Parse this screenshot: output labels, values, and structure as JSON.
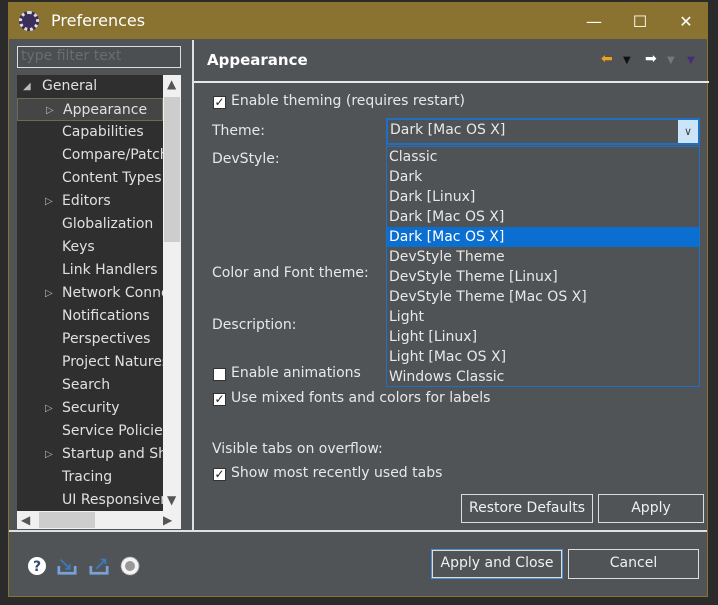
{
  "window": {
    "title": "Preferences",
    "minimize": "—",
    "maximize": "☐",
    "close": "✕"
  },
  "filter": {
    "placeholder": "type filter text"
  },
  "tree": {
    "items": [
      {
        "label": "General",
        "level": 0,
        "expanded": true
      },
      {
        "label": "Appearance",
        "level": 1,
        "expandable": true,
        "selected": true
      },
      {
        "label": "Capabilities",
        "level": 1
      },
      {
        "label": "Compare/Patch",
        "level": 1
      },
      {
        "label": "Content Types",
        "level": 1
      },
      {
        "label": "Editors",
        "level": 1,
        "expandable": true
      },
      {
        "label": "Globalization",
        "level": 1
      },
      {
        "label": "Keys",
        "level": 1
      },
      {
        "label": "Link Handlers",
        "level": 1
      },
      {
        "label": "Network Connections",
        "level": 1,
        "expandable": true
      },
      {
        "label": "Notifications",
        "level": 1
      },
      {
        "label": "Perspectives",
        "level": 1
      },
      {
        "label": "Project Natures",
        "level": 1
      },
      {
        "label": "Search",
        "level": 1
      },
      {
        "label": "Security",
        "level": 1,
        "expandable": true
      },
      {
        "label": "Service Policies",
        "level": 1
      },
      {
        "label": "Startup and Shutdown",
        "level": 1,
        "expandable": true
      },
      {
        "label": "Tracing",
        "level": 1
      },
      {
        "label": "UI Responsiveness",
        "level": 1
      }
    ]
  },
  "page": {
    "title": "Appearance",
    "enable_theming": {
      "label": "Enable theming (requires restart)",
      "checked": true
    },
    "theme_label": "Theme:",
    "theme_value": "Dark [Mac OS X]",
    "theme_options": [
      "Classic",
      "Dark",
      "Dark [Linux]",
      "Dark [Mac OS X]",
      "Dark [Mac OS X]",
      "DevStyle Theme",
      "DevStyle Theme [Linux]",
      "DevStyle Theme [Mac OS X]",
      "Light",
      "Light [Linux]",
      "Light [Mac OS X]",
      "Windows Classic"
    ],
    "theme_highlighted_index": 4,
    "devstyle_label": "DevStyle:",
    "color_font_label": "Color and Font theme:",
    "description_label": "Description:",
    "enable_animations": {
      "label": "Enable animations",
      "checked": false
    },
    "mixed_fonts": {
      "label": "Use mixed fonts and colors for labels",
      "checked": true
    },
    "visible_tabs_label": "Visible tabs on overflow:",
    "show_mru": {
      "label": "Show most recently used tabs",
      "checked": true
    },
    "restore_defaults": "Restore Defaults",
    "apply": "Apply"
  },
  "footer": {
    "apply_close": "Apply and Close",
    "cancel": "Cancel",
    "icons": [
      "help-icon",
      "import-icon",
      "export-icon",
      "record-icon"
    ]
  },
  "colors": {
    "titlebar": "#8a7330",
    "background": "#505457",
    "selection": "#0b6fd1"
  }
}
